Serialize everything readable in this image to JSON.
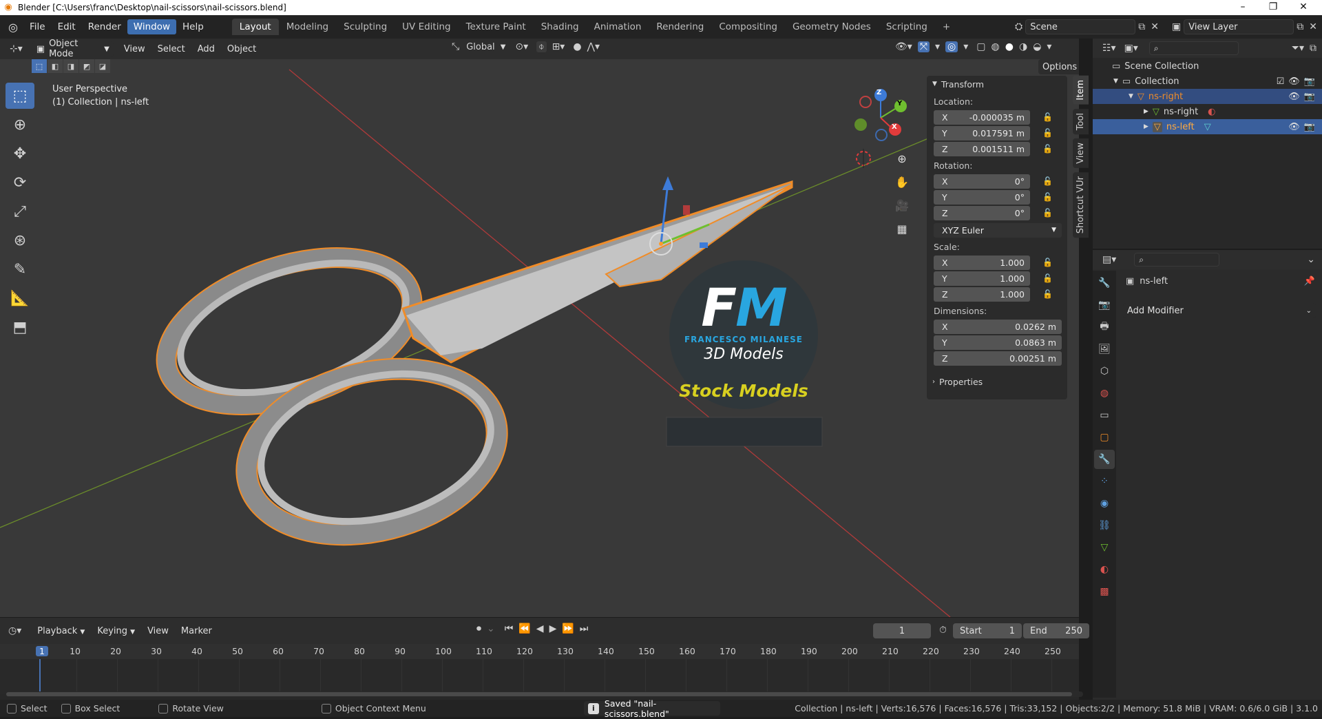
{
  "window": {
    "title": "Blender [C:\\Users\\franc\\Desktop\\nail-scissors\\nail-scissors.blend]",
    "controls": [
      "–",
      "❐",
      "✕"
    ]
  },
  "topbar": {
    "menus": [
      "File",
      "Edit",
      "Render",
      "Window",
      "Help"
    ],
    "active_menu": "Window",
    "workspaces": [
      "Layout",
      "Modeling",
      "Sculpting",
      "UV Editing",
      "Texture Paint",
      "Shading",
      "Animation",
      "Rendering",
      "Compositing",
      "Geometry Nodes",
      "Scripting"
    ],
    "active_workspace": "Layout",
    "add_tab": "+",
    "scene": "Scene",
    "view_layer": "View Layer"
  },
  "viewport_header": {
    "mode": "Object Mode",
    "menus": [
      "View",
      "Select",
      "Add",
      "Object"
    ],
    "orientation": "Global",
    "options": "Options"
  },
  "viewport": {
    "perspective": "User Perspective",
    "collection_info": "(1) Collection | ns-left",
    "gizmo_axes": [
      "X",
      "Y",
      "Z"
    ],
    "watermark": {
      "initials": "FM",
      "name": "FRANCESCO MILANESE",
      "subtitle": "3D Models",
      "badge": "Stock Models"
    }
  },
  "n_panel": {
    "header": "Transform",
    "location_label": "Location:",
    "location": {
      "x": "-0.000035 m",
      "y": "0.017591 m",
      "z": "0.001511 m"
    },
    "rotation_label": "Rotation:",
    "rotation": {
      "x": "0°",
      "y": "0°",
      "z": "0°"
    },
    "rotation_mode": "XYZ Euler",
    "scale_label": "Scale:",
    "scale": {
      "x": "1.000",
      "y": "1.000",
      "z": "1.000"
    },
    "dimensions_label": "Dimensions:",
    "dimensions": {
      "x": "0.0262 m",
      "y": "0.0863 m",
      "z": "0.00251 m"
    },
    "properties": "Properties",
    "tabs": [
      "Item",
      "Tool",
      "View",
      "Shortcut VUr"
    ]
  },
  "outliner": {
    "rows": [
      {
        "label": "Scene Collection"
      },
      {
        "label": "Collection"
      },
      {
        "label": "ns-right"
      },
      {
        "label": "ns-right"
      },
      {
        "label": "ns-left"
      }
    ]
  },
  "properties": {
    "object_name": "ns-left",
    "add_modifier": "Add Modifier"
  },
  "timeline": {
    "menus": [
      "Playback",
      "Keying",
      "View",
      "Marker"
    ],
    "current_frame": "1",
    "start_label": "Start",
    "start": "1",
    "end_label": "End",
    "end": "250",
    "ruler": [
      "1",
      "10",
      "20",
      "30",
      "40",
      "50",
      "60",
      "70",
      "80",
      "90",
      "100",
      "110",
      "120",
      "130",
      "140",
      "150",
      "160",
      "170",
      "180",
      "190",
      "200",
      "210",
      "220",
      "230",
      "240",
      "250"
    ]
  },
  "statusbar": {
    "select": "Select",
    "box_select": "Box Select",
    "rotate_view": "Rotate View",
    "context_menu": "Object Context Menu",
    "message": "Saved \"nail-scissors.blend\"",
    "stats": "Collection | ns-left | Verts:16,576 | Faces:16,576 | Tris:33,152 | Objects:2/2 | Memory: 51.8 MiB | VRAM: 0.6/6.0 GiB | 3.1.0"
  },
  "colors": {
    "accent": "#4772b3",
    "selection_orange": "#f08c28",
    "active_outline": "#ffaa40",
    "watermark_blue": "#29a6e0",
    "badge_yellow": "#d8d020"
  }
}
